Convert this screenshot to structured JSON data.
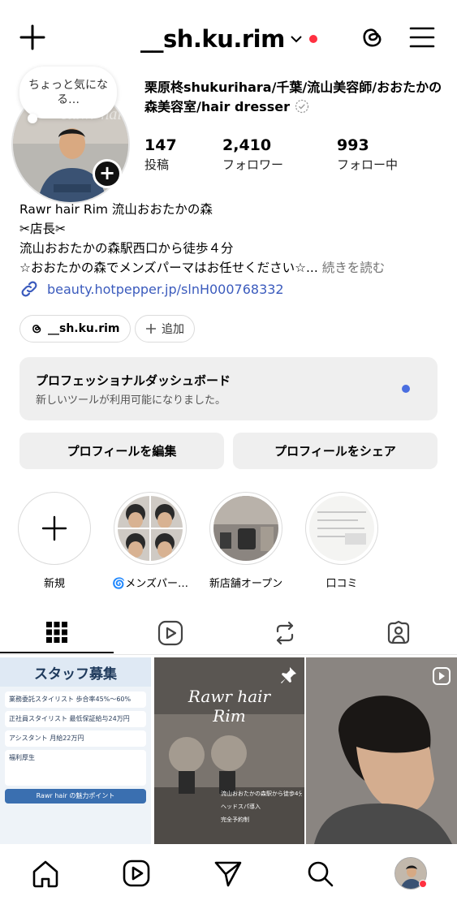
{
  "header": {
    "username": "__sh.ku.rim"
  },
  "profile": {
    "note": "ちょっと気になる…",
    "fullname": "栗原柊shukurihara/千葉/流山美容師/おおたかの森美容室/hair dresser",
    "stats": {
      "posts": {
        "value": "147",
        "label": "投稿"
      },
      "followers": {
        "value": "2,410",
        "label": "フォロワー"
      },
      "following": {
        "value": "993",
        "label": "フォロー中"
      }
    },
    "bio": {
      "line1": "Rawr hair Rim 流山おおたかの森",
      "line2": "✂︎店長✂︎",
      "line3": "流山おおたかの森駅西口から徒歩４分",
      "line4": "☆おおたかの森でメンズパーマはお任せください☆...",
      "more": "続きを読む"
    },
    "link": "beauty.hotpepper.jp/slnH000768332",
    "chips": {
      "threads": "__sh.ku.rim",
      "add": "追加"
    }
  },
  "dashboard": {
    "title": "プロフェッショナルダッシュボード",
    "subtitle": "新しいツールが利用可能になりました。"
  },
  "actions": {
    "edit": "プロフィールを編集",
    "share": "プロフィールをシェア"
  },
  "highlights": [
    {
      "label": "新規"
    },
    {
      "label": "🌀メンズパー…"
    },
    {
      "label": "新店舗オープン"
    },
    {
      "label": "口コミ"
    }
  ],
  "posts": {
    "p1": {
      "title": "スタッフ募集",
      "lines": [
        "業務委託スタイリスト 歩合率45%〜60%",
        "正社員スタイリスト 最低保証給与24万円",
        "アシスタント 月給22万円",
        "福利厚生",
        "Rawr hair の魅力ポイント"
      ]
    },
    "p2": {
      "title1": "Rawr hair",
      "title2": "Rim",
      "items": [
        "流山おおたかの森駅から徒歩4分",
        "ヘッドスパ導入",
        "完全予約制"
      ]
    }
  },
  "colors": {
    "notification": "#ff3040",
    "link": "#3b5bbd",
    "dashboard_dot": "#4a6ee0"
  }
}
